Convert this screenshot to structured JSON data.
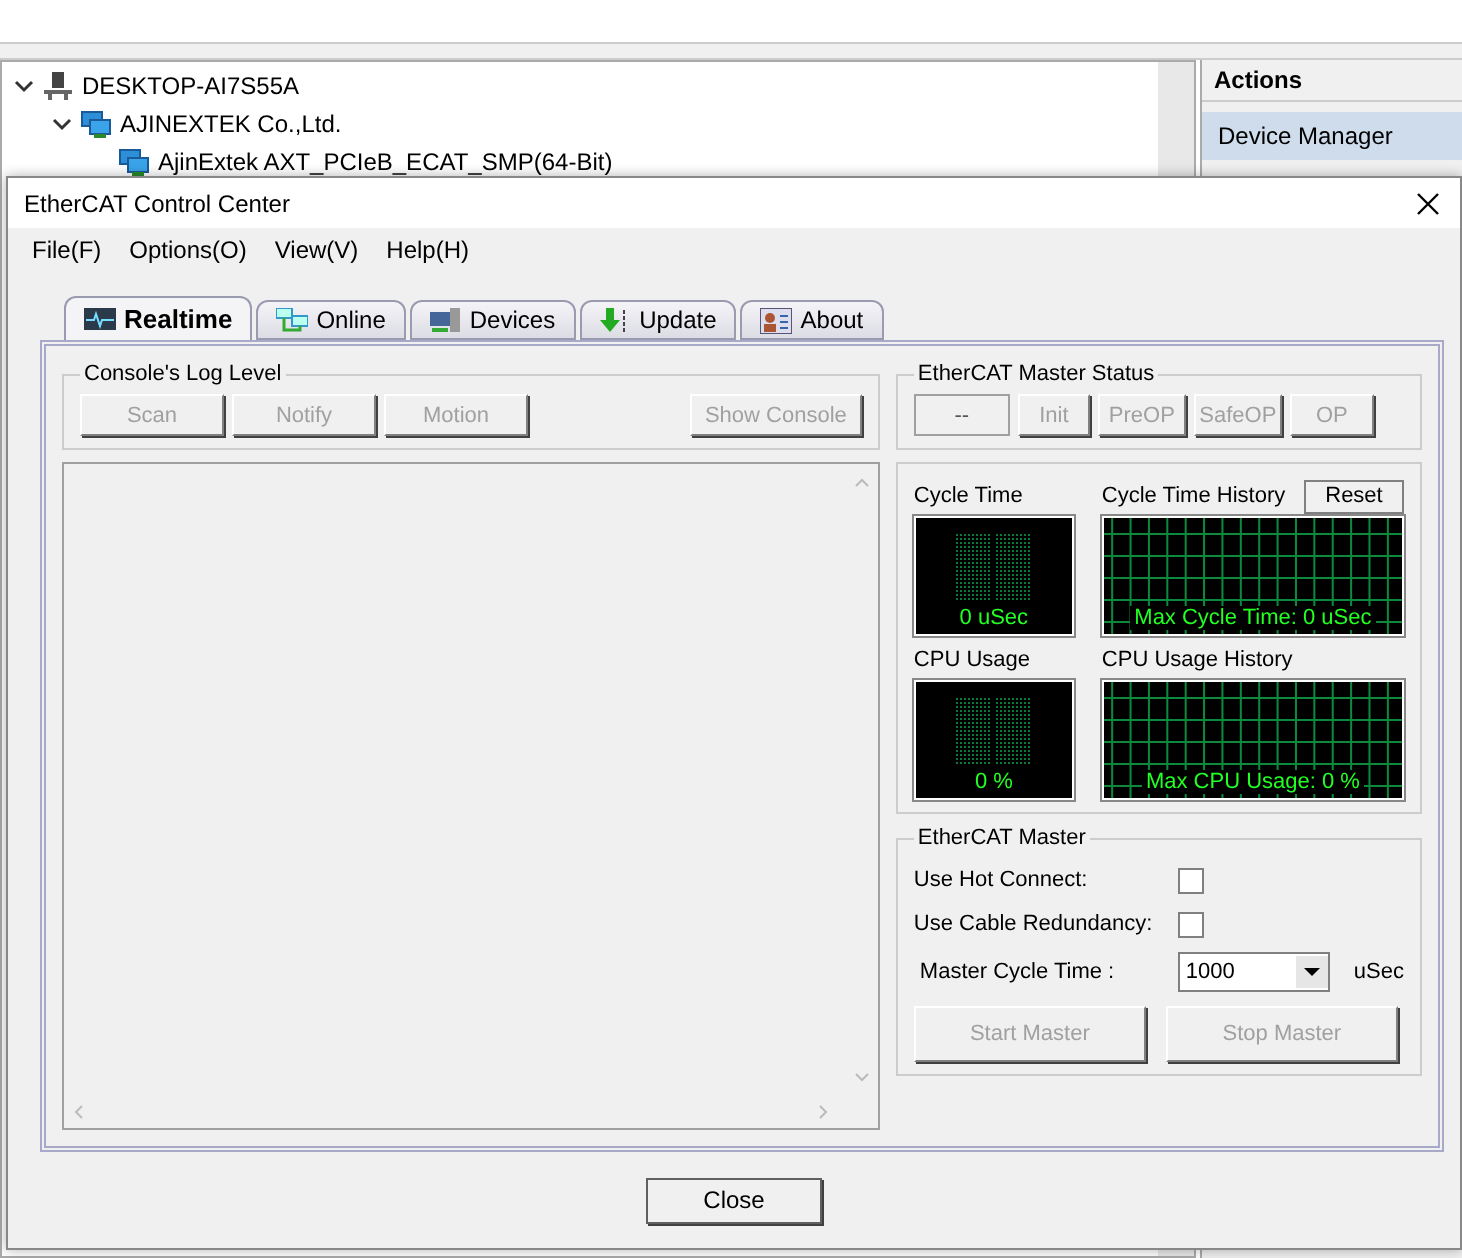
{
  "background_window": {
    "tree": [
      {
        "label": "DESKTOP-AI7S55A",
        "expanded": true,
        "children": [
          {
            "label": "AJINEXTEK Co.,Ltd.",
            "expanded": true,
            "children": [
              {
                "label": "AjinExtek AXT_PCIeB_ECAT_SMP(64-Bit)"
              }
            ]
          }
        ]
      }
    ],
    "actions_title": "Actions",
    "actions": [
      {
        "label": "Device Manager",
        "selected": true
      }
    ]
  },
  "dialog": {
    "title": "EtherCAT Control Center",
    "menu": [
      "File(F)",
      "Options(O)",
      "View(V)",
      "Help(H)"
    ],
    "tabs": [
      {
        "label": "Realtime",
        "selected": true
      },
      {
        "label": "Online",
        "selected": false
      },
      {
        "label": "Devices",
        "selected": false
      },
      {
        "label": "Update",
        "selected": false
      },
      {
        "label": "About",
        "selected": false
      }
    ],
    "log_level": {
      "title": "Console's Log Level",
      "buttons": [
        {
          "label": "Scan",
          "disabled": true
        },
        {
          "label": "Notify",
          "disabled": true
        },
        {
          "label": "Motion",
          "disabled": true
        }
      ],
      "show_console": {
        "label": "Show Console",
        "disabled": true
      }
    },
    "master_status": {
      "title": "EtherCAT Master Status",
      "state": "--",
      "buttons": [
        {
          "label": "Init",
          "disabled": true
        },
        {
          "label": "PreOP",
          "disabled": true
        },
        {
          "label": "SafeOP",
          "disabled": true
        },
        {
          "label": "OP",
          "disabled": true
        }
      ]
    },
    "monitors": [
      {
        "label": "Cycle Time",
        "kind": "gauge",
        "reading": "0 uSec"
      },
      {
        "label": "Cycle Time History",
        "kind": "history",
        "reading": "Max Cycle Time: 0 uSec",
        "reset": "Reset"
      },
      {
        "label": "CPU Usage",
        "kind": "gauge",
        "reading": "0 %"
      },
      {
        "label": "CPU Usage History",
        "kind": "history",
        "reading": "Max CPU Usage: 0 %"
      }
    ],
    "master": {
      "title": "EtherCAT Master",
      "options": [
        {
          "label": "Use Hot Connect:",
          "checked": false
        },
        {
          "label": "Use Cable Redundancy:",
          "checked": false
        }
      ],
      "cycle_label": "Master Cycle Time :",
      "cycle_value": "1000",
      "cycle_unit": "uSec",
      "buttons": [
        {
          "label": "Start Master",
          "disabled": true
        },
        {
          "label": "Stop Master",
          "disabled": true
        }
      ]
    },
    "close_button": "Close"
  }
}
